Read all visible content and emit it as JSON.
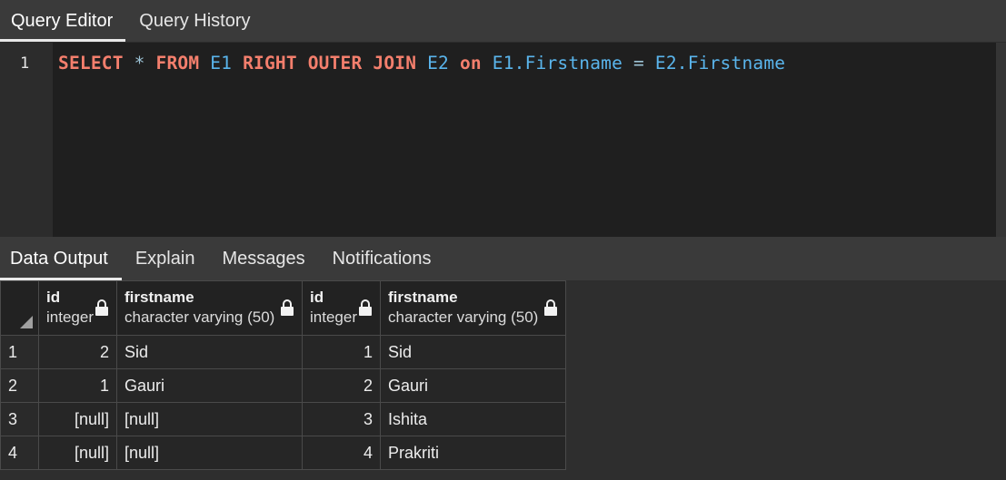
{
  "editor_tabs": [
    "Query Editor",
    "Query History"
  ],
  "editor": {
    "line_number": "1",
    "tokens": {
      "select": "SELECT",
      "star": "*",
      "from": "FROM",
      "t1": "E1",
      "right": "RIGHT",
      "outer": "OUTER",
      "join": "JOIN",
      "t2": "E2",
      "on": "on",
      "left_col": "E1.Firstname",
      "eq": "=",
      "right_col": "E2.Firstname"
    }
  },
  "output_tabs": [
    "Data Output",
    "Explain",
    "Messages",
    "Notifications"
  ],
  "results": {
    "columns": [
      {
        "name": "id",
        "type": "integer"
      },
      {
        "name": "firstname",
        "type": "character varying (50)"
      },
      {
        "name": "id",
        "type": "integer"
      },
      {
        "name": "firstname",
        "type": "character varying (50)"
      }
    ],
    "rows": [
      {
        "n": "1",
        "c": [
          "2",
          "Sid",
          "1",
          "Sid"
        ]
      },
      {
        "n": "2",
        "c": [
          "1",
          "Gauri",
          "2",
          "Gauri"
        ]
      },
      {
        "n": "3",
        "c": [
          "[null]",
          "[null]",
          "3",
          "Ishita"
        ]
      },
      {
        "n": "4",
        "c": [
          "[null]",
          "[null]",
          "4",
          "Prakriti"
        ]
      }
    ]
  },
  "icons": {
    "lock": "lock-icon",
    "corner": "select-all-corner-icon"
  },
  "colors": {
    "keyword": "#f47f6d",
    "identifier": "#5ab5ec",
    "null": "#8a8a8a"
  }
}
